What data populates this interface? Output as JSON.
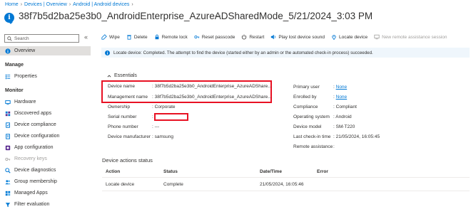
{
  "breadcrumb": [
    "Home",
    "Devices | Overview",
    "Android | Android devices"
  ],
  "page": {
    "title": "38f7b5d2ba25e3b0_AndroidEnterprise_AzureADSharedMode_5/21/2024_3:03 PM",
    "more": "···"
  },
  "sidebar": {
    "search_placeholder": "Search",
    "collapse": "«",
    "overview": "Overview",
    "manage_heading": "Manage",
    "manage_items": [
      "Properties"
    ],
    "monitor_heading": "Monitor",
    "monitor_items": [
      {
        "label": "Hardware",
        "disabled": false
      },
      {
        "label": "Discovered apps",
        "disabled": false
      },
      {
        "label": "Device compliance",
        "disabled": false
      },
      {
        "label": "Device configuration",
        "disabled": false
      },
      {
        "label": "App configuration",
        "disabled": false
      },
      {
        "label": "Recovery keys",
        "disabled": true
      },
      {
        "label": "Device diagnostics",
        "disabled": false
      },
      {
        "label": "Group membership",
        "disabled": false
      },
      {
        "label": "Managed Apps",
        "disabled": false
      },
      {
        "label": "Filter evaluation",
        "disabled": false
      }
    ]
  },
  "toolbar": {
    "wipe": "Wipe",
    "delete": "Delete",
    "remote_lock": "Remote lock",
    "reset_passcode": "Reset passcode",
    "restart": "Restart",
    "play_lost_sound": "Play lost device sound",
    "locate_device": "Locate device",
    "new_remote_assistance": "New remote assistance session"
  },
  "banner": {
    "text": "Locate device: Completed. The attempt to find the device (started either by an admin or the automated check-in process) succeeded."
  },
  "essentials": {
    "heading": "Essentials",
    "left": [
      {
        "label": "Device name",
        "value": ": 38f7b5d2ba25e3b0_AndroidEnterprise_AzureADShare..."
      },
      {
        "label": "Management name",
        "value": ": 38f7b5d2ba25e3b0_AndroidEnterprise_AzureADShare..."
      },
      {
        "label": "Ownership",
        "value": ": Corporate"
      },
      {
        "label": "Serial number",
        "value": ":"
      },
      {
        "label": "Phone number",
        "value": ": ---"
      },
      {
        "label": "Device manufacturer",
        "value": ": samsung"
      }
    ],
    "right": [
      {
        "label": "Primary user",
        "value": "None"
      },
      {
        "label": "Enrolled by",
        "value": "None"
      },
      {
        "label": "Compliance",
        "value": "Compliant"
      },
      {
        "label": "Operating system",
        "value": "Android"
      },
      {
        "label": "Device model",
        "value": "SM-T220"
      },
      {
        "label": "Last check-in time",
        "value": "21/05/2024, 16:05:45"
      },
      {
        "label": "Remote assistance",
        "value": ""
      }
    ]
  },
  "actions_status": {
    "title": "Device actions status",
    "columns": [
      "Action",
      "Status",
      "Date/Time",
      "Error"
    ],
    "rows": [
      {
        "action": "Locate device",
        "status": "Complete",
        "datetime": "21/05/2024, 16:05:46",
        "error": ""
      }
    ]
  },
  "colors": {
    "accent": "#0078d4",
    "highlight_box": "#e81123",
    "banner_bg": "#eff6fc",
    "active_nav": "#e1dfdd"
  }
}
